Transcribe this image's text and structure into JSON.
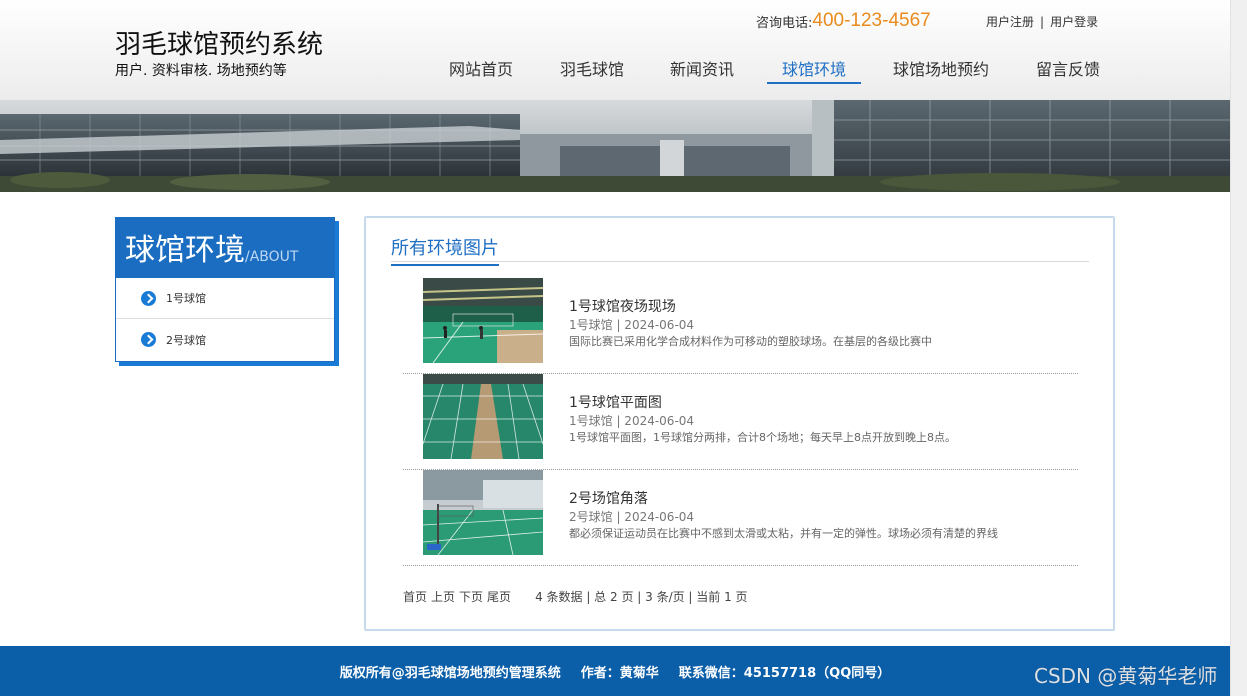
{
  "header": {
    "site_title": "羽毛球馆预约系统",
    "site_subtitle": "用户. 资料审核. 场地预约等",
    "hotline_label": "咨询电话:",
    "hotline_number": "400-123-4567",
    "register": "用户注册",
    "separator": "|",
    "login": "用户登录"
  },
  "nav": {
    "items": [
      {
        "label": "网站首页"
      },
      {
        "label": "羽毛球馆"
      },
      {
        "label": "新闻资讯"
      },
      {
        "label": "球馆环境"
      },
      {
        "label": "球馆场地预约"
      },
      {
        "label": "留言反馈"
      }
    ],
    "active_label": "球馆环境"
  },
  "sidebar": {
    "title": "球馆环境",
    "subtitle": "/ABOUT",
    "items": [
      {
        "label": "1号球馆"
      },
      {
        "label": "2号球馆"
      }
    ]
  },
  "main": {
    "title": "所有环境图片",
    "items": [
      {
        "title": "1号球馆夜场现场",
        "meta": "1号球馆 | 2024-06-04",
        "desc": "国际比赛已采用化学合成材料作为可移动的塑胶球场。在基层的各级比赛中"
      },
      {
        "title": "1号球馆平面图",
        "meta": "1号球馆 | 2024-06-04",
        "desc": "1号球馆平面图，1号球馆分两排，合计8个场地；每天早上8点开放到晚上8点。"
      },
      {
        "title": "2号场馆角落",
        "meta": "2号球馆 | 2024-06-04",
        "desc": "都必须保证运动员在比赛中不感到太滑或太粘，并有一定的弹性。球场必须有清楚的界线"
      }
    ],
    "pager": {
      "first": "首页",
      "prev": "上页",
      "next": "下页",
      "last": "尾页",
      "info": "4 条数据 | 总 2 页 | 3 条/页 | 当前 1 页"
    }
  },
  "footer": {
    "copyright": "版权所有@羽毛球馆场地预约管理系统",
    "author": "作者：黄菊华",
    "contact": "联系微信：45157718（QQ同号）"
  },
  "watermark": "CSDN @黄菊华老师",
  "colors": {
    "accent": "#1f6fc3",
    "hotline": "#e98b1d",
    "footer_bg": "#0b5ea8"
  }
}
